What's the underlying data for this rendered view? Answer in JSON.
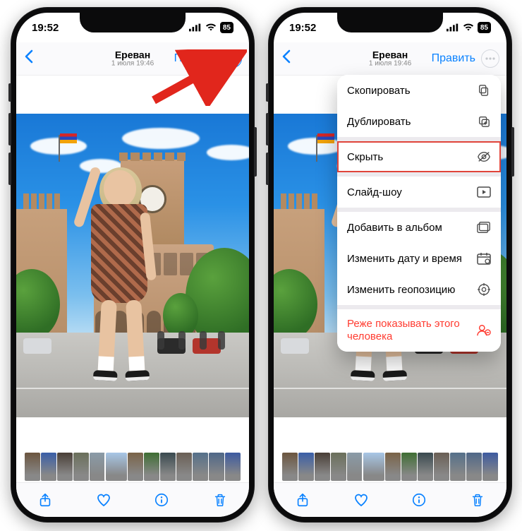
{
  "status": {
    "time": "19:52",
    "battery": "85"
  },
  "nav": {
    "title": "Ереван",
    "subtitle": "1 июля  19:46",
    "edit": "Править"
  },
  "menu": {
    "copy": "Скопировать",
    "duplicate": "Дублировать",
    "hide": "Скрыть",
    "slideshow": "Слайд-шоу",
    "add_to_album": "Добавить в альбом",
    "change_datetime": "Изменить дату и время",
    "change_location": "Изменить геопозицию",
    "feature_less": "Реже показывать этого человека"
  },
  "thumbs": [
    "#6b553f",
    "#3a5ea8",
    "#4a3f37",
    "#6a6f5a",
    "#8a9ba8",
    "#a8c6e6",
    "#7a6348",
    "#3f6e33",
    "#3a4a4f",
    "#6a5f55",
    "#55708a",
    "#4f6788",
    "#3d5aa0"
  ],
  "thumb_selected_index": 5
}
